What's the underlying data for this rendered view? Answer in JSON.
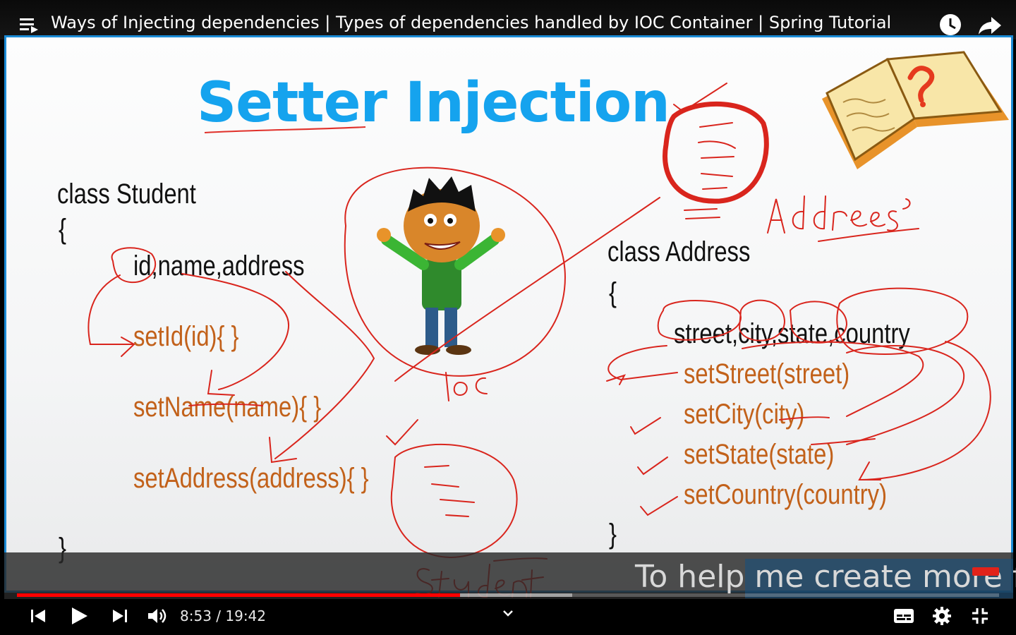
{
  "window": {
    "title": "Ways of Injecting dependencies | Types of dependencies handled by IOC Container | Spring Tutorial"
  },
  "slide": {
    "title": "Setter Injection",
    "student_class": {
      "header": "class Student",
      "open_brace": "{",
      "fields": "id,name,address",
      "setters": [
        "setId(id){ }",
        "setName(name){ }",
        "setAddress(address){ }"
      ],
      "close_brace": "}"
    },
    "address_class": {
      "header": "class Address",
      "open_brace": "{",
      "fields": "street,city,state,country",
      "setters": [
        "setStreet(street)",
        "setCity(city)",
        "setState(state)",
        "setCountry(country)"
      ],
      "close_brace": "}"
    },
    "handwriting": {
      "ioc": "IOC",
      "address": "Address",
      "student": "Student"
    }
  },
  "overlay": {
    "text": "To help me create more f"
  },
  "player": {
    "current_time": "8:53",
    "duration": "19:42",
    "time_display": "8:53 / 19:42",
    "progress_fraction": 0.4509,
    "buffered_fraction": 0.5656,
    "colors": {
      "played": "#ff0000",
      "accent": "#15a3ee"
    },
    "icons": [
      "menu-icon",
      "clock-icon",
      "share-icon",
      "previous-icon",
      "play-icon",
      "next-icon",
      "volume-icon",
      "chevron-down-icon",
      "captions-icon",
      "settings-icon",
      "exit-fullscreen-icon"
    ]
  }
}
